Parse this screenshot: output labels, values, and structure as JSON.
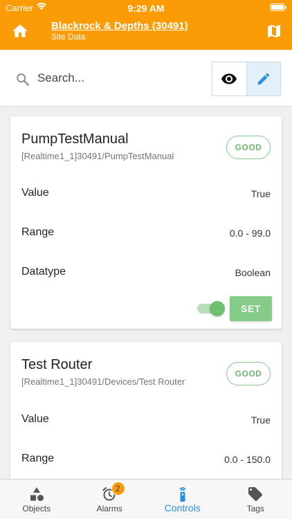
{
  "status_bar": {
    "carrier": "Carrier",
    "time": "9:29 AM"
  },
  "header": {
    "site_title": "Blackrock & Depths (30491)",
    "site_subtitle": "Site Data",
    "home_icon": "home-icon",
    "map_icon": "map-icon",
    "color": "#fb9c06"
  },
  "search": {
    "placeholder": "Search...",
    "value": "",
    "view_toggle": "eye-icon",
    "edit_toggle": "pencil-icon"
  },
  "cards": [
    {
      "title": "PumpTestManual",
      "path": "[Realtime1_1]30491/PumpTestManual",
      "status": "GOOD",
      "rows": [
        {
          "label": "Value",
          "value": "True"
        },
        {
          "label": "Range",
          "value": "0.0 - 99.0"
        },
        {
          "label": "Datatype",
          "value": "Boolean"
        }
      ],
      "switch_on": true,
      "set_label": "SET"
    },
    {
      "title": "Test Router",
      "path": "[Realtime1_1]30491/Devices/Test Router",
      "status": "GOOD",
      "rows": [
        {
          "label": "Value",
          "value": "True"
        },
        {
          "label": "Range",
          "value": "0.0 - 150.0"
        }
      ]
    }
  ],
  "tabs": [
    {
      "label": "Objects",
      "icon": "shapes-icon"
    },
    {
      "label": "Alarms",
      "icon": "alarm-clock-icon",
      "badge": "2"
    },
    {
      "label": "Controls",
      "icon": "remote-icon",
      "active": true
    },
    {
      "label": "Tags",
      "icon": "tag-icon"
    }
  ],
  "colors": {
    "accent": "#fb9c06",
    "active_tab": "#2a8fe0",
    "good": "#6cb570",
    "set_button": "#85cc89"
  }
}
